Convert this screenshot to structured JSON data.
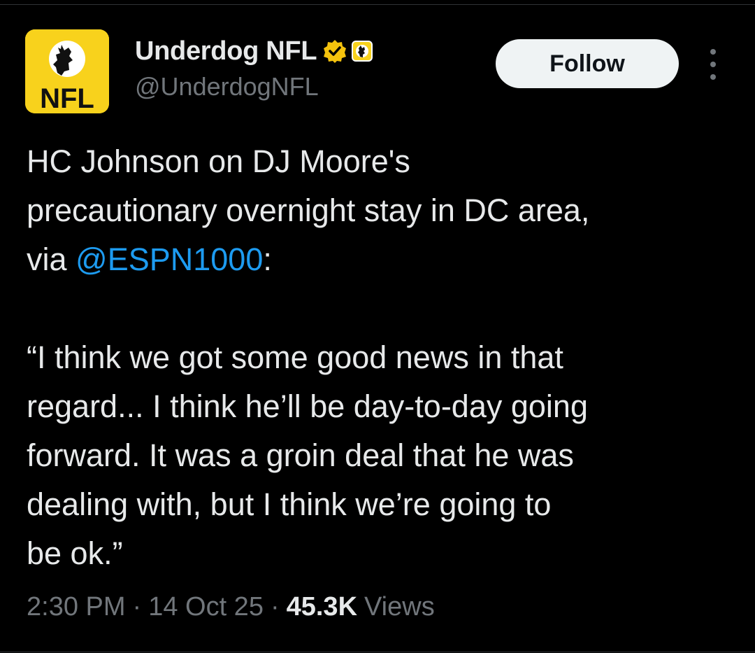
{
  "author": {
    "display_name": "Underdog NFL",
    "handle": "@UnderdogNFL",
    "avatar_text": "NFL",
    "verified_color": "#f4c20d",
    "avatar_color": "#f8d21c"
  },
  "actions": {
    "follow_label": "Follow",
    "more_icon": "more-vertical-icon"
  },
  "tweet": {
    "line1_before": "HC Johnson on DJ Moore's\nprecautionary overnight stay in DC area,\nvia ",
    "mention": "@ESPN1000",
    "line1_after": ":",
    "quote": "“I think we got some good news in that\nregard... I think he’ll be day-to-day going\nforward. It was a groin deal that he was\ndealing with, but I think we’re going to\nbe ok.”"
  },
  "meta": {
    "time": "2:30 PM",
    "date": "14 Oct 25",
    "views_count": "45.3K",
    "views_label": "Views",
    "separator": "·"
  }
}
